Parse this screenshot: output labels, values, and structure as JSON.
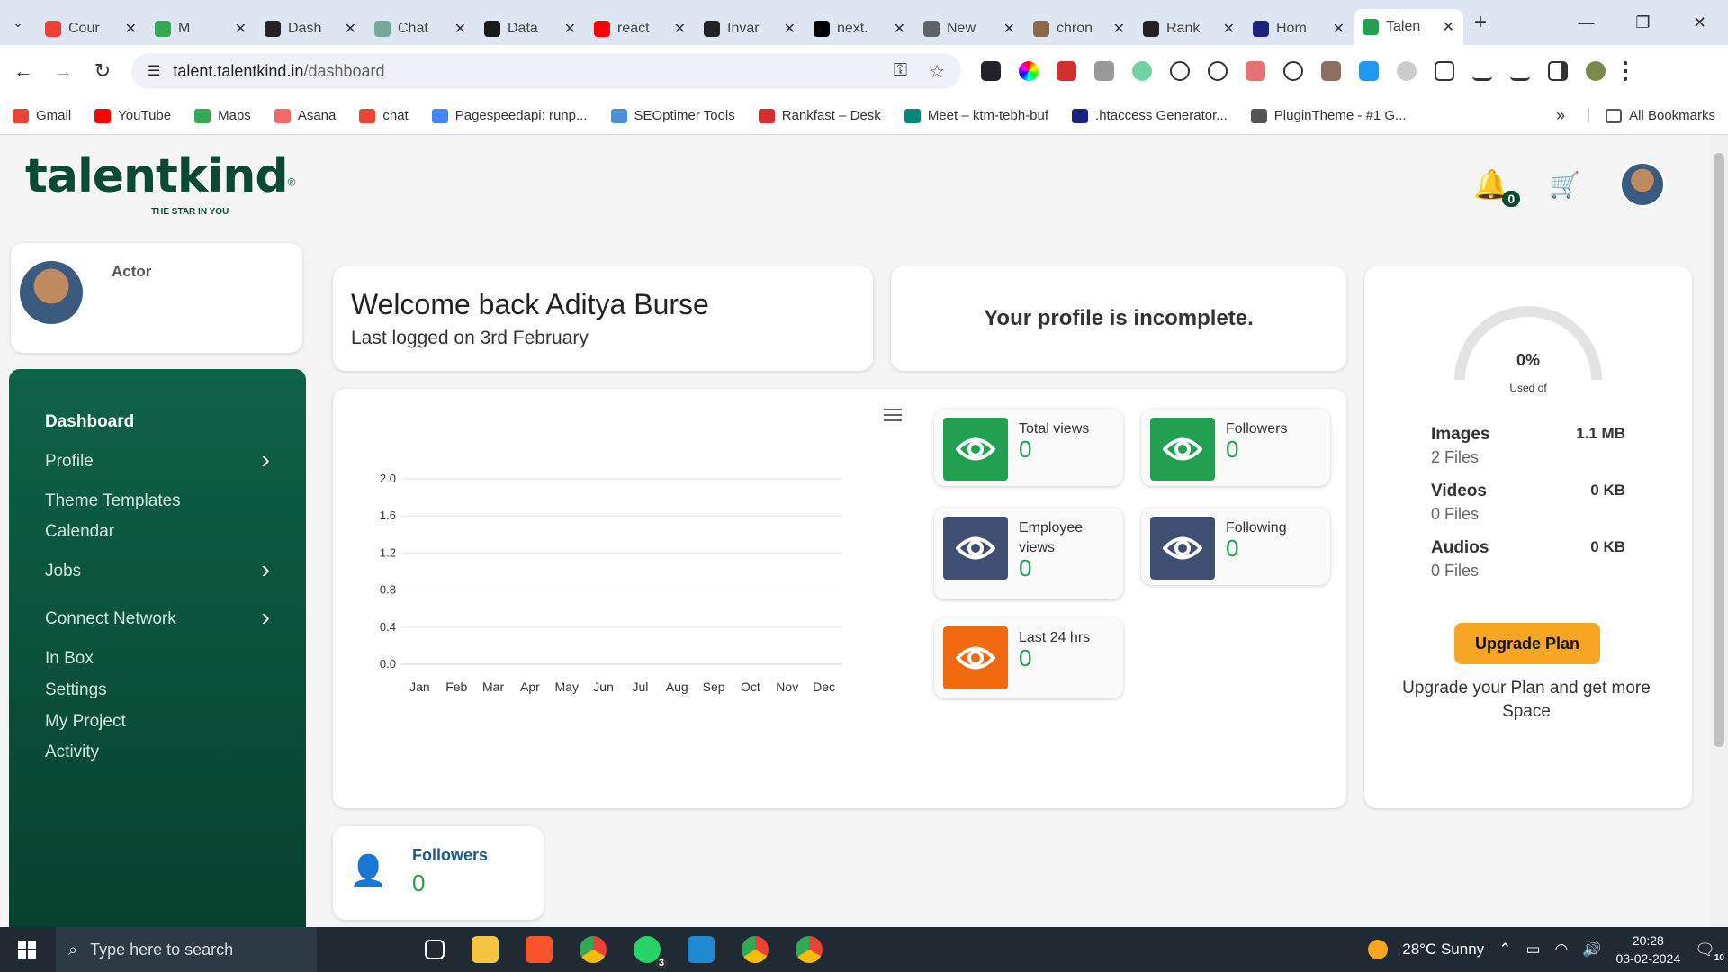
{
  "browser": {
    "tabs": [
      {
        "title": "Cour",
        "color": "#ea4335"
      },
      {
        "title": "M",
        "color": "#34a853"
      },
      {
        "title": "Dash",
        "color": "#222222"
      },
      {
        "title": "Chat",
        "color": "#74aa9c"
      },
      {
        "title": "Data",
        "color": "#1a1a1a"
      },
      {
        "title": "react",
        "color": "#ff0000"
      },
      {
        "title": "Invar",
        "color": "#222222"
      },
      {
        "title": "next.",
        "color": "#000000"
      },
      {
        "title": "New",
        "color": "#5f6368"
      },
      {
        "title": "chron",
        "color": "#8a6a4a"
      },
      {
        "title": "Rank",
        "color": "#222222"
      },
      {
        "title": "Hom",
        "color": "#1a237e"
      },
      {
        "title": "Talen",
        "color": "#22a052",
        "active": true
      }
    ],
    "url_host": "talent.talentkind.in",
    "url_path": "/dashboard",
    "bookmarks": [
      {
        "label": "Gmail",
        "color": "#ea4335"
      },
      {
        "label": "YouTube",
        "color": "#ff0000"
      },
      {
        "label": "Maps",
        "color": "#34a853"
      },
      {
        "label": "Asana",
        "color": "#f06a6a"
      },
      {
        "label": "chat",
        "color": "#ea4335"
      },
      {
        "label": "Pagespeedapi: runp...",
        "color": "#4285f4"
      },
      {
        "label": "SEOptimer Tools",
        "color": "#4a90d9"
      },
      {
        "label": "Rankfast – Desk",
        "color": "#d32f2f"
      },
      {
        "label": "Meet – ktm-tebh-buf",
        "color": "#00897b"
      },
      {
        "label": ".htaccess Generator...",
        "color": "#1a237e"
      },
      {
        "label": "PluginTheme - #1 G...",
        "color": "#555555"
      }
    ],
    "all_bookmarks": "All Bookmarks"
  },
  "header": {
    "logo_text": "talentkind",
    "logo_reg": "®",
    "logo_tagline": "THE STAR IN YOU",
    "notif_count": "0"
  },
  "profile": {
    "role": "Actor"
  },
  "sidebar": {
    "items": [
      {
        "label": "Dashboard",
        "active": true,
        "chevron": false
      },
      {
        "label": "Profile",
        "chevron": true
      },
      {
        "label": "Theme Templates",
        "chevron": false
      },
      {
        "label": "Calendar",
        "chevron": false
      },
      {
        "label": "Jobs",
        "chevron": true
      },
      {
        "label": "Connect Network",
        "chevron": true
      },
      {
        "label": "In Box",
        "chevron": false
      },
      {
        "label": "Settings",
        "chevron": false
      },
      {
        "label": "My Project",
        "chevron": false
      },
      {
        "label": "Activity",
        "chevron": false
      }
    ]
  },
  "welcome": {
    "title": "Welcome back Aditya Burse",
    "subtitle": "Last logged on 3rd February"
  },
  "profile_status": "Your profile is incomplete.",
  "chart_data": {
    "type": "bar",
    "categories": [
      "Jan",
      "Feb",
      "Mar",
      "Apr",
      "May",
      "Jun",
      "Jul",
      "Aug",
      "Sep",
      "Oct",
      "Nov",
      "Dec"
    ],
    "values": [
      0,
      0,
      0,
      0,
      0,
      0,
      0,
      0,
      0,
      0,
      0,
      0
    ],
    "yticks": [
      "2.0",
      "1.6",
      "1.2",
      "0.8",
      "0.4",
      "0.0"
    ],
    "ylim": [
      0,
      2.0
    ],
    "grid": true
  },
  "stats": [
    {
      "label": "Total views",
      "value": "0",
      "color": "#22a052"
    },
    {
      "label": "Followers",
      "value": "0",
      "color": "#22a052"
    },
    {
      "label": "Employee views",
      "value": "0",
      "color": "#3f4f72"
    },
    {
      "label": "Following",
      "value": "0",
      "color": "#3f4f72"
    },
    {
      "label": "Last 24 hrs",
      "value": "0",
      "color": "#f26a10"
    }
  ],
  "storage": {
    "percent": "0%",
    "used_of": "Used of",
    "items": [
      {
        "name": "Images",
        "size": "1.1 MB",
        "files": "2 Files"
      },
      {
        "name": "Videos",
        "size": "0 KB",
        "files": "0 Files"
      },
      {
        "name": "Audios",
        "size": "0 KB",
        "files": "0 Files"
      }
    ],
    "upgrade_label": "Upgrade Plan",
    "upgrade_msg": "Upgrade your Plan and get more Space"
  },
  "followers_card": {
    "label": "Followers",
    "value": "0"
  },
  "taskbar": {
    "search_placeholder": "Type here to search",
    "weather": "28°C  Sunny",
    "time": "20:28",
    "date": "03-02-2024",
    "notif_count": "10",
    "whatsapp_badge": "3"
  }
}
